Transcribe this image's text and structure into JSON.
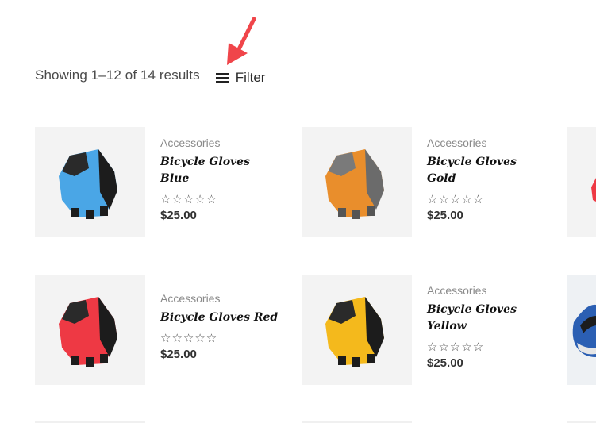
{
  "toolbar": {
    "results_text": "Showing 1–12 of 14 results",
    "filter_label": "Filter",
    "filter_icon": "hamburger-menu-icon",
    "annotation_arrow_color": "#f0454a"
  },
  "products": [
    {
      "category": "Accessories",
      "title": "Bicycle Gloves Blue",
      "rating_stars": "☆☆☆☆☆",
      "price": "$25.00",
      "image_icon": "glove-image",
      "color": "#4aa6e6"
    },
    {
      "category": "Accessories",
      "title": "Bicycle Gloves Gold",
      "rating_stars": "☆☆☆☆☆",
      "price": "$25.00",
      "image_icon": "glove-image",
      "color": "#e98e2c"
    },
    {
      "category": "Accessories",
      "title": "Bicycle Gloves Red",
      "rating_stars": "☆☆☆☆☆",
      "price": "$25.00",
      "image_icon": "glove-image",
      "color": "#ee3944"
    },
    {
      "category": "Accessories",
      "title": "Bicycle Gloves Yellow",
      "rating_stars": "☆☆☆☆☆",
      "price": "$25.00",
      "image_icon": "glove-image",
      "color": "#f4b91c"
    }
  ]
}
